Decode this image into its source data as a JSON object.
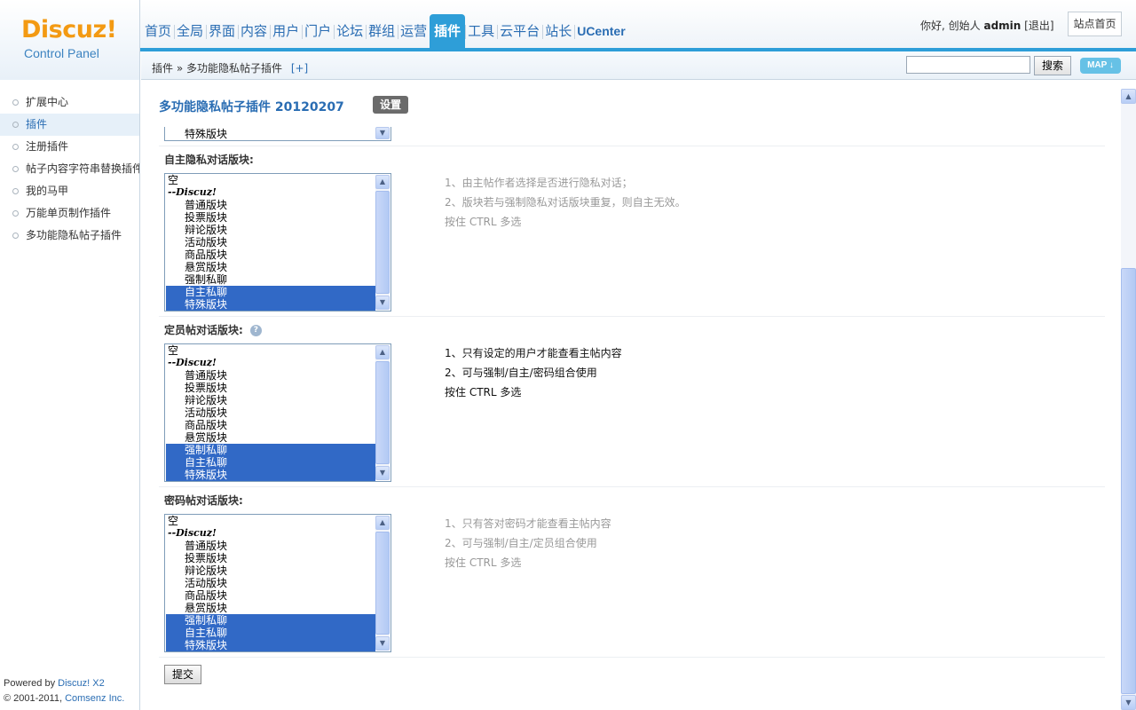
{
  "header": {
    "logo": "Discuz!",
    "logo_sub": "Control Panel",
    "nav": [
      "首页",
      "全局",
      "界面",
      "内容",
      "用户",
      "门户",
      "论坛",
      "群组",
      "运营",
      "插件",
      "工具",
      "云平台",
      "站长",
      "UCenter"
    ],
    "active_nav": "插件",
    "greeting": "你好, 创始人",
    "username": "admin",
    "logout": "[退出]",
    "site_home": "站点首页"
  },
  "subbar": {
    "breadcrumb": "插件 » 多功能隐私帖子插件",
    "add": "[+]",
    "search_button": "搜索",
    "map_button": "MAP ↓"
  },
  "sidebar": {
    "items": [
      "扩展中心",
      "插件",
      "注册插件",
      "帖子内容字符串替换插件",
      "我的马甲",
      "万能单页制作插件",
      "多功能隐私帖子插件"
    ],
    "active_index": 1,
    "powered_prefix": "Powered by ",
    "powered_name": "Discuz! X2",
    "copyright_prefix": "© 2001-2011, ",
    "copyright_name": "Comsenz Inc."
  },
  "main": {
    "title": "多功能隐私帖子插件 20120207",
    "settings_button": "设置",
    "partial_option": "特殊版块",
    "sections": [
      {
        "label": "自主隐私对话版块:",
        "help": false,
        "notes": [
          "1、由主帖作者选择是否进行隐私对话；",
          "2、版块若与强制隐私对话版块重复，则自主无效。",
          "按住 CTRL 多选"
        ],
        "notes_dark": false,
        "options": [
          "空",
          "--Discuz!",
          "普通版块",
          "投票版块",
          "辩论版块",
          "活动版块",
          "商品版块",
          "悬赏版块",
          "强制私聊",
          "自主私聊",
          "特殊版块"
        ],
        "selected": [
          9,
          10
        ]
      },
      {
        "label": "定员帖对话版块:",
        "help": true,
        "notes": [
          "1、只有设定的用户才能查看主帖内容",
          "2、可与强制/自主/密码组合使用",
          "按住 CTRL 多选"
        ],
        "notes_dark": true,
        "options": [
          "空",
          "--Discuz!",
          "普通版块",
          "投票版块",
          "辩论版块",
          "活动版块",
          "商品版块",
          "悬赏版块",
          "强制私聊",
          "自主私聊",
          "特殊版块"
        ],
        "selected": [
          8,
          9,
          10
        ]
      },
      {
        "label": "密码帖对话版块:",
        "help": false,
        "notes": [
          "1、只有答对密码才能查看主帖内容",
          "2、可与强制/自主/定员组合使用",
          "按住 CTRL 多选"
        ],
        "notes_dark": false,
        "options": [
          "空",
          "--Discuz!",
          "普通版块",
          "投票版块",
          "辩论版块",
          "活动版块",
          "商品版块",
          "悬赏版块",
          "强制私聊",
          "自主私聊",
          "特殊版块"
        ],
        "selected": [
          8,
          9,
          10
        ]
      }
    ],
    "submit": "提交"
  }
}
